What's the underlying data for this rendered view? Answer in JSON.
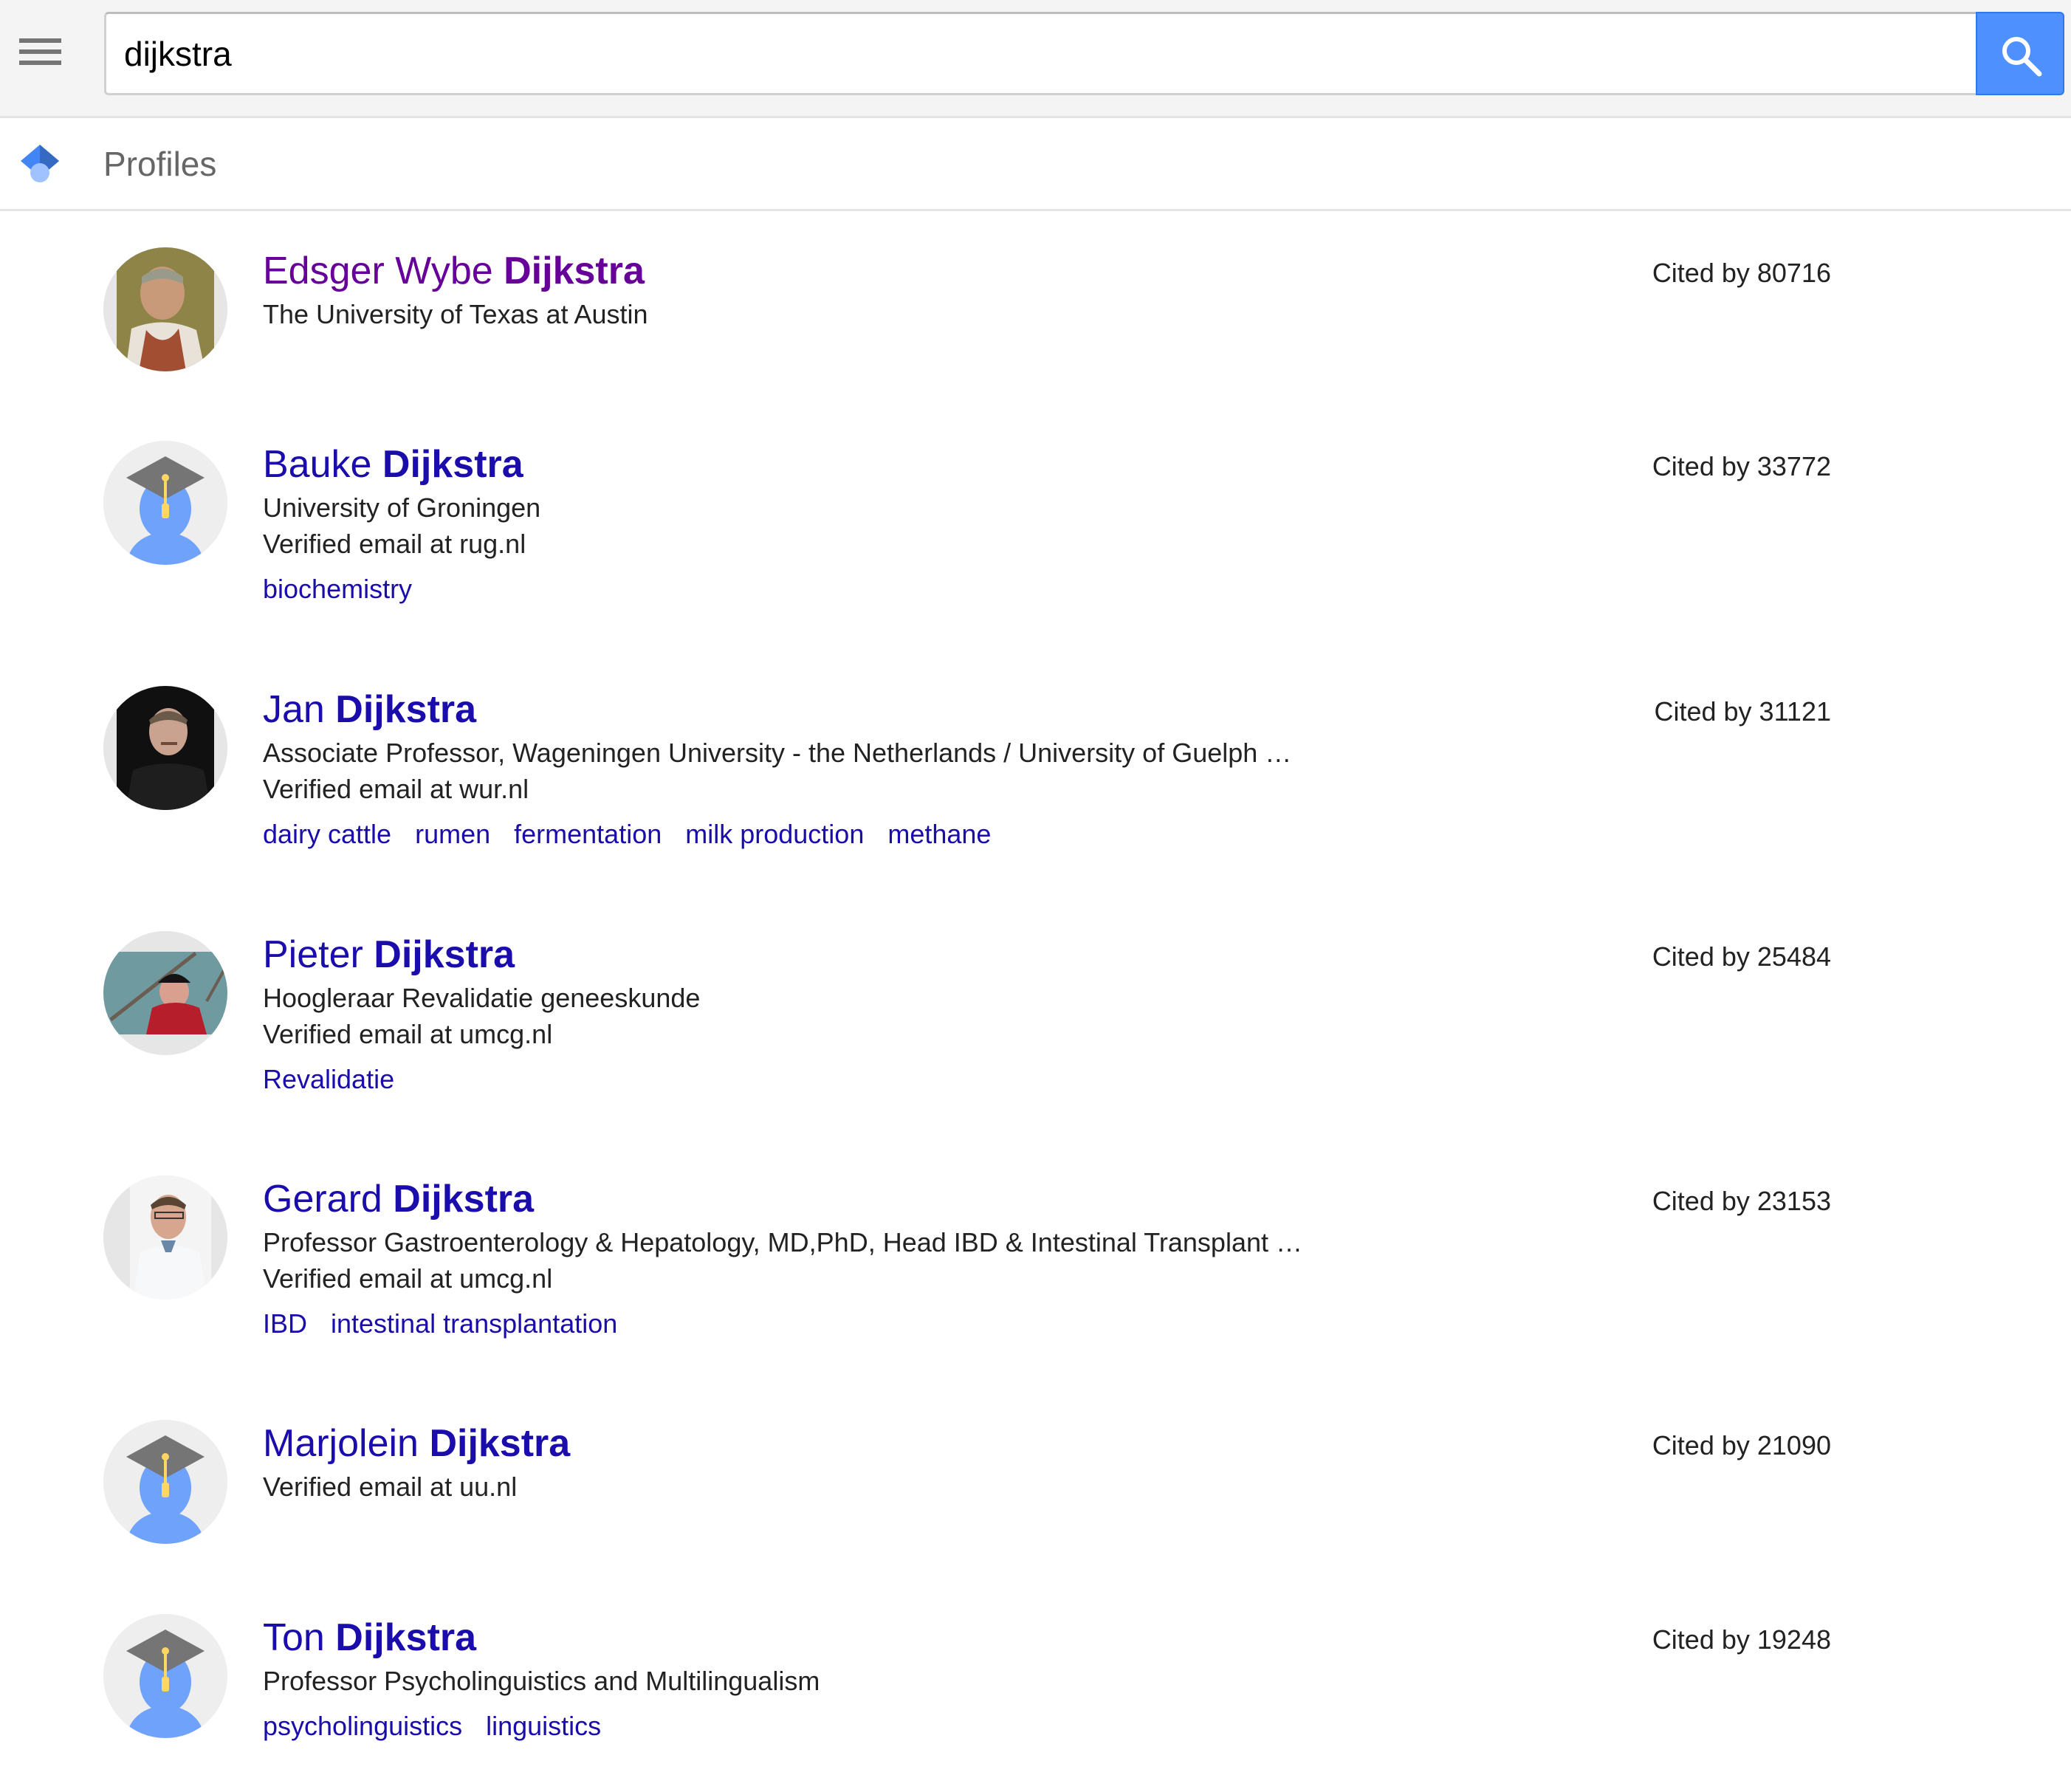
{
  "search": {
    "query": "dijkstra",
    "placeholder": ""
  },
  "icons": {
    "menu": "hamburger-menu-icon",
    "search": "magnifier-icon",
    "logo": "scholar-cap-icon"
  },
  "colors": {
    "accent": "#4d90fe",
    "link": "#1a0dab",
    "visited_link": "#660099",
    "text": "#222222",
    "muted": "#666666"
  },
  "section": {
    "title": "Profiles"
  },
  "results": [
    {
      "first_name": "Edsger Wybe",
      "last_name": "Dijkstra",
      "visited": true,
      "avatar": "photo",
      "lines": [
        "The University of Texas at Austin"
      ],
      "tags": [],
      "cited": "Cited by 80716"
    },
    {
      "first_name": "Bauke",
      "last_name": "Dijkstra",
      "visited": false,
      "avatar": "default",
      "lines": [
        "University of Groningen",
        "Verified email at rug.nl"
      ],
      "tags": [
        "biochemistry"
      ],
      "cited": "Cited by 33772"
    },
    {
      "first_name": "Jan",
      "last_name": "Dijkstra",
      "visited": false,
      "avatar": "photo",
      "lines": [
        "Associate Professor, Wageningen University - the Netherlands / University of Guelph …",
        "Verified email at wur.nl"
      ],
      "tags": [
        "dairy cattle",
        "rumen",
        "fermentation",
        "milk production",
        "methane"
      ],
      "cited": "Cited by 31121"
    },
    {
      "first_name": "Pieter",
      "last_name": "Dijkstra",
      "visited": false,
      "avatar": "photo",
      "lines": [
        "Hoogleraar Revalidatie geneeskunde",
        "Verified email at umcg.nl"
      ],
      "tags": [
        "Revalidatie"
      ],
      "cited": "Cited by 25484"
    },
    {
      "first_name": "Gerard",
      "last_name": "Dijkstra",
      "visited": false,
      "avatar": "photo",
      "lines": [
        "Professor Gastroenterology & Hepatology, MD,PhD, Head IBD & Intestinal Transplant …",
        "Verified email at umcg.nl"
      ],
      "tags": [
        "IBD",
        "intestinal transplantation"
      ],
      "cited": "Cited by 23153"
    },
    {
      "first_name": "Marjolein",
      "last_name": "Dijkstra",
      "visited": false,
      "avatar": "default",
      "lines": [
        "Verified email at uu.nl"
      ],
      "tags": [],
      "cited": "Cited by 21090"
    },
    {
      "first_name": "Ton",
      "last_name": "Dijkstra",
      "visited": false,
      "avatar": "default",
      "lines": [
        "Professor Psycholinguistics and Multilingualism"
      ],
      "tags": [
        "psycholinguistics",
        "linguistics"
      ],
      "cited": "Cited by 19248"
    }
  ]
}
